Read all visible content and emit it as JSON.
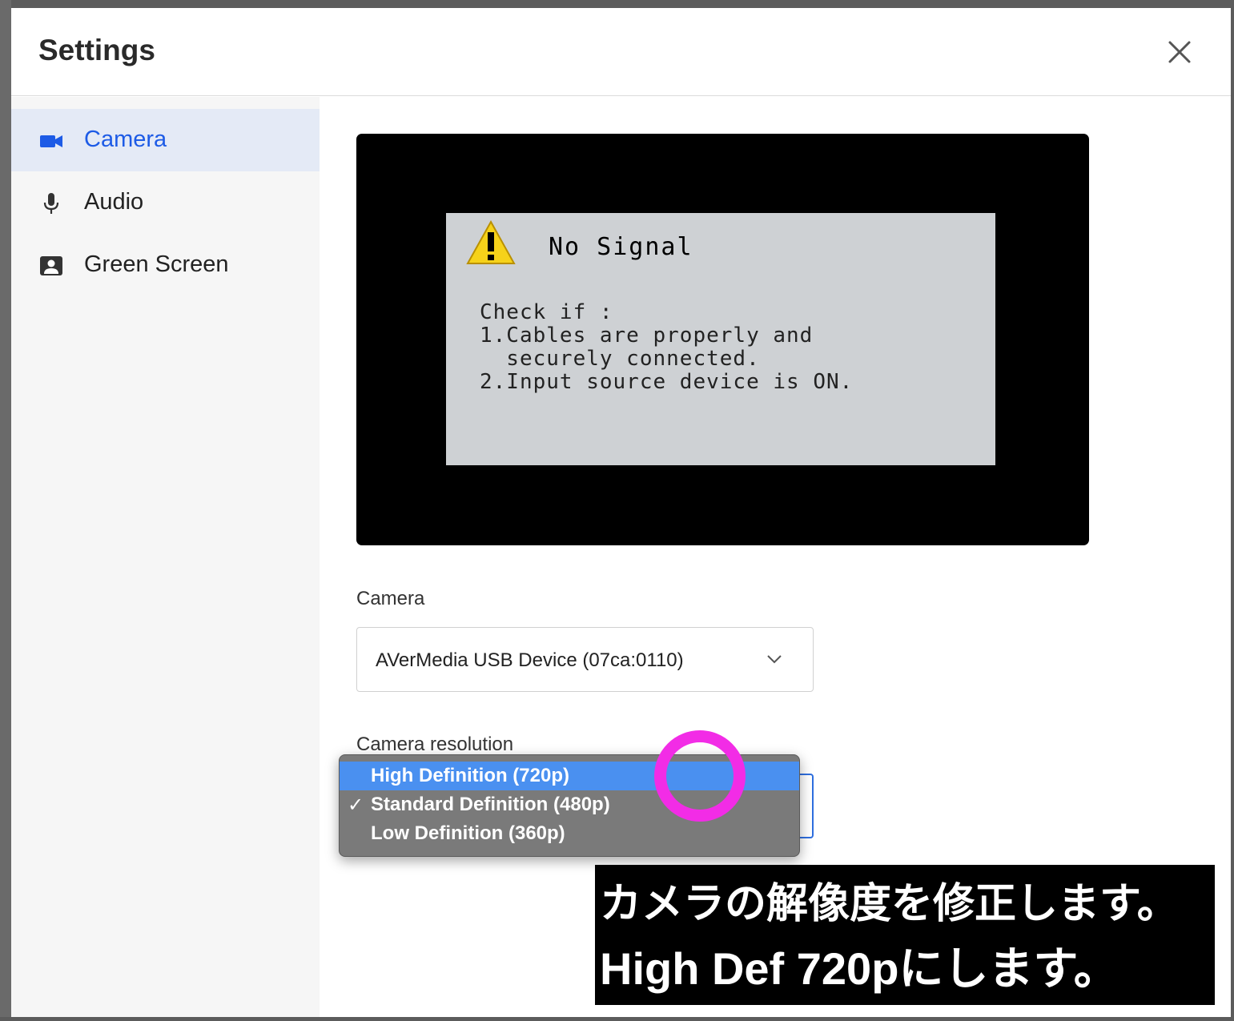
{
  "window": {
    "title": "Settings"
  },
  "sidebar": {
    "items": [
      {
        "label": "Camera",
        "icon": "video-camera-icon",
        "active": true
      },
      {
        "label": "Audio",
        "icon": "microphone-icon",
        "active": false
      },
      {
        "label": "Green Screen",
        "icon": "portrait-icon",
        "active": false
      }
    ]
  },
  "preview": {
    "osd_title": "No Signal",
    "osd_text": "Check if :\n1.Cables are properly and\n  securely connected.\n2.Input source device is ON."
  },
  "camera": {
    "label": "Camera",
    "selected": "AVerMedia USB Device (07ca:0110)"
  },
  "resolution": {
    "label": "Camera resolution",
    "options": [
      {
        "label": "High Definition (720p)",
        "highlighted": true,
        "checked": false
      },
      {
        "label": "Standard Definition (480p)",
        "highlighted": false,
        "checked": true
      },
      {
        "label": "Low Definition (360p)",
        "highlighted": false,
        "checked": false
      }
    ],
    "check_mark": "✓"
  },
  "caption": {
    "line1": "カメラの解像度を修正します。",
    "line2": "High Def 720pにします。"
  },
  "colors": {
    "accent": "#1d5be6",
    "active_bg": "#e4eaf6",
    "highlight": "#4a90f0",
    "annotation_ring": "#f22ce6"
  }
}
